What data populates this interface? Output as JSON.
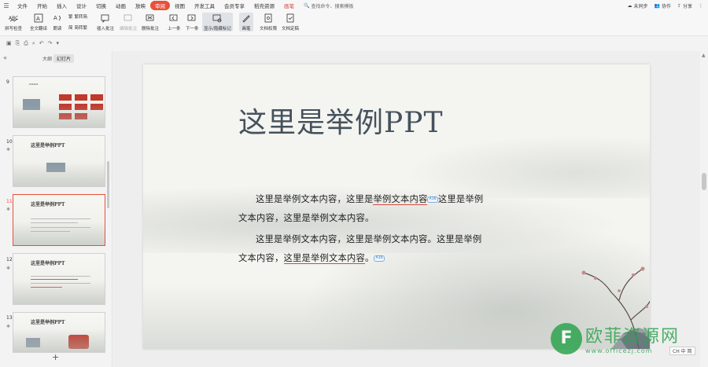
{
  "menu": {
    "items": [
      "文件",
      "开始",
      "插入",
      "设计",
      "切换",
      "动画",
      "放映",
      "审阅",
      "视图",
      "开发工具",
      "会员专享",
      "稻壳资源",
      "画笔"
    ],
    "active_index": 7,
    "search_label": "查找命令、搜索模板",
    "right": [
      "未同步",
      "协作",
      "分享"
    ]
  },
  "ribbon": {
    "spell": "拼写检查",
    "translate": "全文翻译",
    "proofread": "朗读",
    "trad": "繁转简",
    "simp": "简转繁",
    "insert_comment": "插入批注",
    "edit_comment": "编辑批注",
    "delete_comment": "删除批注",
    "prev": "上一条",
    "next": "下一条",
    "show_hide": "显示/隐藏标记",
    "pen": "画笔",
    "doc_perm": "文档权限",
    "doc_final": "文档定稿"
  },
  "panel": {
    "tab_outline": "大纲",
    "tab_slides": "幻灯片",
    "slides": [
      {
        "num": "9"
      },
      {
        "num": "10",
        "title": "这里是举例PPT"
      },
      {
        "num": "11",
        "title": "这里是举例PPT"
      },
      {
        "num": "12",
        "title": "这里是举例PPT"
      },
      {
        "num": "13",
        "title": "这里是举例PPT"
      }
    ]
  },
  "slide": {
    "title": "这里是举例PPT",
    "p1_a": "这里是举例文本内容，这里是",
    "p1_mark": "举例文本内容",
    "p1_cmt": "A16",
    "p1_b": "这里是举例文本内容，这里是举例文本内容。",
    "p2_a": "这里是举例文本内容，这里是举例文本内容。这里是举例文本内容，",
    "p2_mark": "这里是举例文本内容",
    "p2_end": "。",
    "p2_cmt": "A16"
  },
  "status": {
    "badge": "CH 中 简"
  },
  "watermark": {
    "cn": "欧菲资源网",
    "en": "www.officezj.com",
    "logo": "F"
  }
}
